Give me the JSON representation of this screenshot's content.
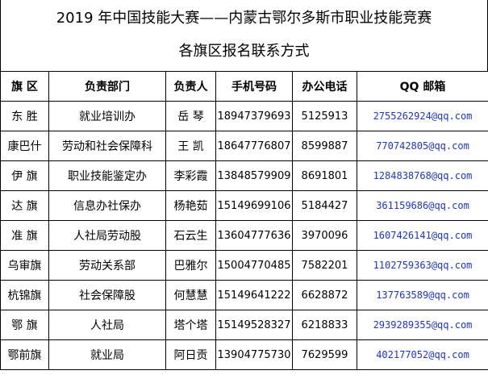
{
  "title": {
    "line1": "2019 年中国技能大赛——内蒙古鄂尔多斯市职业技能竞赛",
    "line2": "各旗区报名联系方式"
  },
  "headers": [
    "旗 区",
    "负责部门",
    "负责人",
    "手机号码",
    "办公电话",
    "QQ 邮箱"
  ],
  "rows": [
    {
      "district": "东 胜",
      "department": "就业培训办",
      "person": "岳 琴",
      "mobile": "18947379693",
      "office": "5125913",
      "email": "2755262924@qq.com"
    },
    {
      "district": "康巴什",
      "department": "劳动和社会保障科",
      "person": "王 凯",
      "mobile": "18647776807",
      "office": "8599887",
      "email": "770742805@qq.com"
    },
    {
      "district": "伊 旗",
      "department": "职业技能鉴定办",
      "person": "李彩霞",
      "mobile": "13848579909",
      "office": "8691801",
      "email": "1284838768@qq.com"
    },
    {
      "district": "达 旗",
      "department": "信息办社保办",
      "person": "杨艳茹",
      "mobile": "15149699106",
      "office": "5184427",
      "email": "361159686@qq.com"
    },
    {
      "district": "准 旗",
      "department": "人社局劳动股",
      "person": "石云生",
      "mobile": "13604777636",
      "office": "3970096",
      "email": "1607426141@qq.com"
    },
    {
      "district": "乌审旗",
      "department": "劳动关系部",
      "person": "巴雅尔",
      "mobile": "15004770485",
      "office": "7582201",
      "email": "1102759363@qq.com"
    },
    {
      "district": "杭锦旗",
      "department": "社会保障股",
      "person": "何慧慧",
      "mobile": "15149641222",
      "office": "6628872",
      "email": "137763589@qq.com"
    },
    {
      "district": "鄂 旗",
      "department": "人社局",
      "person": "塔个塔",
      "mobile": "15149528327",
      "office": "6218833",
      "email": "2939289355@qq.com"
    },
    {
      "district": "鄂前旗",
      "department": "就业局",
      "person": "阿日贡",
      "mobile": "13904775730",
      "office": "7629599",
      "email": "402177052@qq.com"
    }
  ]
}
